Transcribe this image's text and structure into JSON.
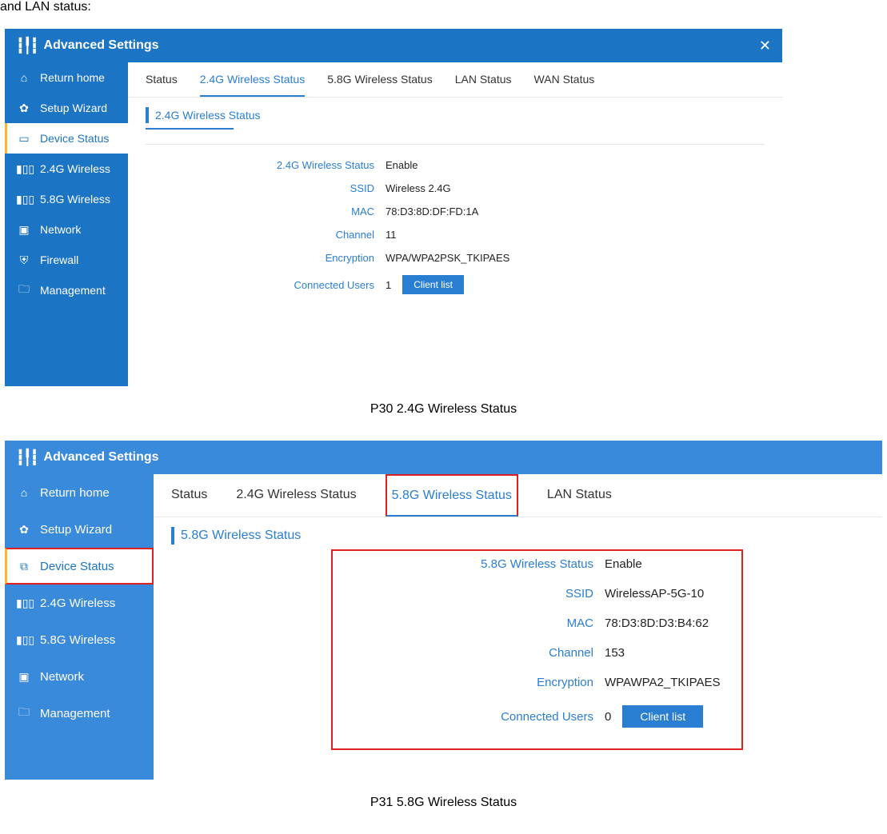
{
  "intro_text": "and LAN status:",
  "caption1": "P30 2.4G Wireless Status",
  "caption2": "P31 5.8G Wireless Status",
  "shot1": {
    "title": "Advanced Settings",
    "sidebar": [
      {
        "icon": "⌂",
        "label": "Return home"
      },
      {
        "icon": "✿",
        "label": "Setup Wizard"
      },
      {
        "icon": "▭",
        "label": "Device Status",
        "active": true
      },
      {
        "icon": "▮▯▯",
        "label": "2.4G Wireless"
      },
      {
        "icon": "▮▯▯",
        "label": "5.8G Wireless"
      },
      {
        "icon": "▣",
        "label": "Network"
      },
      {
        "icon": "⛨",
        "label": "Firewall"
      },
      {
        "icon": "🗀",
        "label": "Management"
      }
    ],
    "tabs": [
      {
        "label": "Status"
      },
      {
        "label": "2.4G Wireless Status",
        "active": true
      },
      {
        "label": "5.8G Wireless Status"
      },
      {
        "label": "LAN Status"
      },
      {
        "label": "WAN Status"
      }
    ],
    "panel_title": "2.4G Wireless Status",
    "fields": [
      {
        "label": "2.4G Wireless Status",
        "value": "Enable"
      },
      {
        "label": "SSID",
        "value": "Wireless 2.4G"
      },
      {
        "label": "MAC",
        "value": "78:D3:8D:DF:FD:1A"
      },
      {
        "label": "Channel",
        "value": "11"
      },
      {
        "label": "Encryption",
        "value": "WPA/WPA2PSK_TKIPAES"
      },
      {
        "label": "Connected Users",
        "value": "1",
        "button": "Client list"
      }
    ]
  },
  "shot2": {
    "title": "Advanced Settings",
    "sidebar": [
      {
        "icon": "⌂",
        "label": "Return home"
      },
      {
        "icon": "✿",
        "label": "Setup Wizard"
      },
      {
        "icon": "⧉",
        "label": "Device Status",
        "active": true
      },
      {
        "icon": "▮▯▯",
        "label": "2.4G Wireless"
      },
      {
        "icon": "▮▯▯",
        "label": "5.8G Wireless"
      },
      {
        "icon": "▣",
        "label": "Network"
      },
      {
        "icon": "🗀",
        "label": "Management"
      }
    ],
    "tabs": [
      {
        "label": "Status"
      },
      {
        "label": "2.4G Wireless Status"
      },
      {
        "label": "5.8G Wireless Status",
        "active": true,
        "highlight": true
      },
      {
        "label": "LAN Status"
      }
    ],
    "panel_title": "5.8G Wireless Status",
    "fields": [
      {
        "label": "5.8G Wireless Status",
        "value": "Enable"
      },
      {
        "label": "SSID",
        "value": "WirelessAP-5G-10"
      },
      {
        "label": "MAC",
        "value": "78:D3:8D:D3:B4:62"
      },
      {
        "label": "Channel",
        "value": "153"
      },
      {
        "label": "Encryption",
        "value": "WPAWPA2_TKIPAES"
      },
      {
        "label": "Connected Users",
        "value": "0",
        "button": "Client list"
      }
    ]
  }
}
